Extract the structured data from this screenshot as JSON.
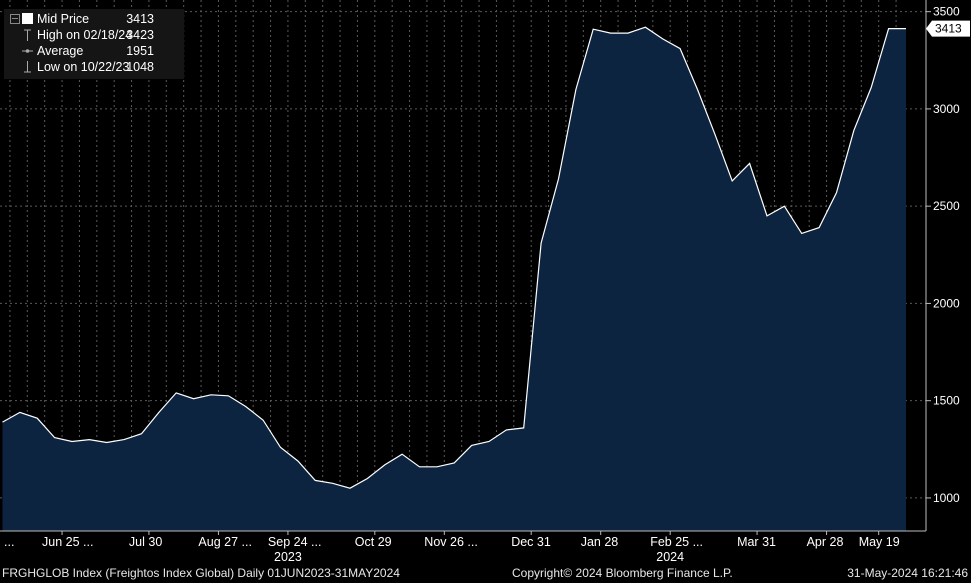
{
  "chart_data": {
    "type": "area",
    "x": [
      "2023-06-01",
      "2023-06-08",
      "2023-06-15",
      "2023-06-22",
      "2023-06-29",
      "2023-07-06",
      "2023-07-13",
      "2023-07-20",
      "2023-07-27",
      "2023-08-03",
      "2023-08-10",
      "2023-08-17",
      "2023-08-24",
      "2023-08-31",
      "2023-09-07",
      "2023-09-14",
      "2023-09-21",
      "2023-09-28",
      "2023-10-05",
      "2023-10-12",
      "2023-10-19",
      "2023-10-26",
      "2023-11-02",
      "2023-11-09",
      "2023-11-16",
      "2023-11-23",
      "2023-11-30",
      "2023-12-07",
      "2023-12-14",
      "2023-12-21",
      "2023-12-28",
      "2024-01-04",
      "2024-01-11",
      "2024-01-18",
      "2024-01-25",
      "2024-02-01",
      "2024-02-08",
      "2024-02-15",
      "2024-02-22",
      "2024-02-29",
      "2024-03-07",
      "2024-03-14",
      "2024-03-21",
      "2024-03-28",
      "2024-04-04",
      "2024-04-11",
      "2024-04-18",
      "2024-04-25",
      "2024-05-02",
      "2024-05-09",
      "2024-05-16",
      "2024-05-23",
      "2024-05-30"
    ],
    "values": [
      1390,
      1440,
      1410,
      1310,
      1290,
      1300,
      1285,
      1300,
      1330,
      1440,
      1540,
      1510,
      1530,
      1525,
      1470,
      1400,
      1260,
      1190,
      1090,
      1075,
      1050,
      1100,
      1170,
      1225,
      1160,
      1160,
      1180,
      1270,
      1290,
      1350,
      1360,
      2310,
      2640,
      3100,
      3410,
      3390,
      3390,
      3420,
      3360,
      3310,
      3100,
      2870,
      2630,
      2720,
      2450,
      2500,
      2360,
      2390,
      2570,
      2890,
      3110,
      3413,
      3413
    ],
    "series_name": "Mid Price",
    "ylim": [
      830,
      3560
    ],
    "yticks": [
      1000,
      1500,
      2000,
      2500,
      3000,
      3500
    ],
    "xticks": [
      {
        "date": "2023-06-25",
        "label": "Jun 25 ..."
      },
      {
        "date": "2023-07-30",
        "label": "Jul 30"
      },
      {
        "date": "2023-08-27",
        "label": "Aug 27 ..."
      },
      {
        "date": "2023-09-24",
        "label": "Sep 24 ..."
      },
      {
        "date": "2023-10-29",
        "label": "Oct 29"
      },
      {
        "date": "2023-11-26",
        "label": "Nov 26 ..."
      },
      {
        "date": "2023-12-31",
        "label": "Dec 31"
      },
      {
        "date": "2024-01-28",
        "label": "Jan 28"
      },
      {
        "date": "2024-02-25",
        "label": "Feb 25 ..."
      },
      {
        "date": "2024-03-31",
        "label": "Mar 31"
      },
      {
        "date": "2024-04-28",
        "label": "Apr 28"
      },
      {
        "date": "2024-05-19",
        "label": "May 19"
      }
    ],
    "leading_tick_label": "...",
    "years": [
      {
        "date": "2023-09-24",
        "label": "2023"
      },
      {
        "date": "2024-02-25",
        "label": "2024"
      }
    ],
    "last_value_label": "3413",
    "grid": true,
    "colors": {
      "fill": "#0c2440",
      "line": "#ffffff",
      "grid": "#5a5a5a",
      "background": "#000000"
    }
  },
  "legend": {
    "items": [
      {
        "label": "Mid Price",
        "value": "3413"
      },
      {
        "label": "High on 02/18/24",
        "value": "3423"
      },
      {
        "label": "Average",
        "value": "1951"
      },
      {
        "label": "Low on 10/22/23",
        "value": "1048"
      }
    ]
  },
  "footer": {
    "index": "FRGHGLOB Index (Freightos Index Global)  Daily 01JUN2023-31MAY2024",
    "copyright": "Copyright© 2024 Bloomberg Finance L.P.",
    "timestamp": "31-May-2024 16:21:46"
  }
}
